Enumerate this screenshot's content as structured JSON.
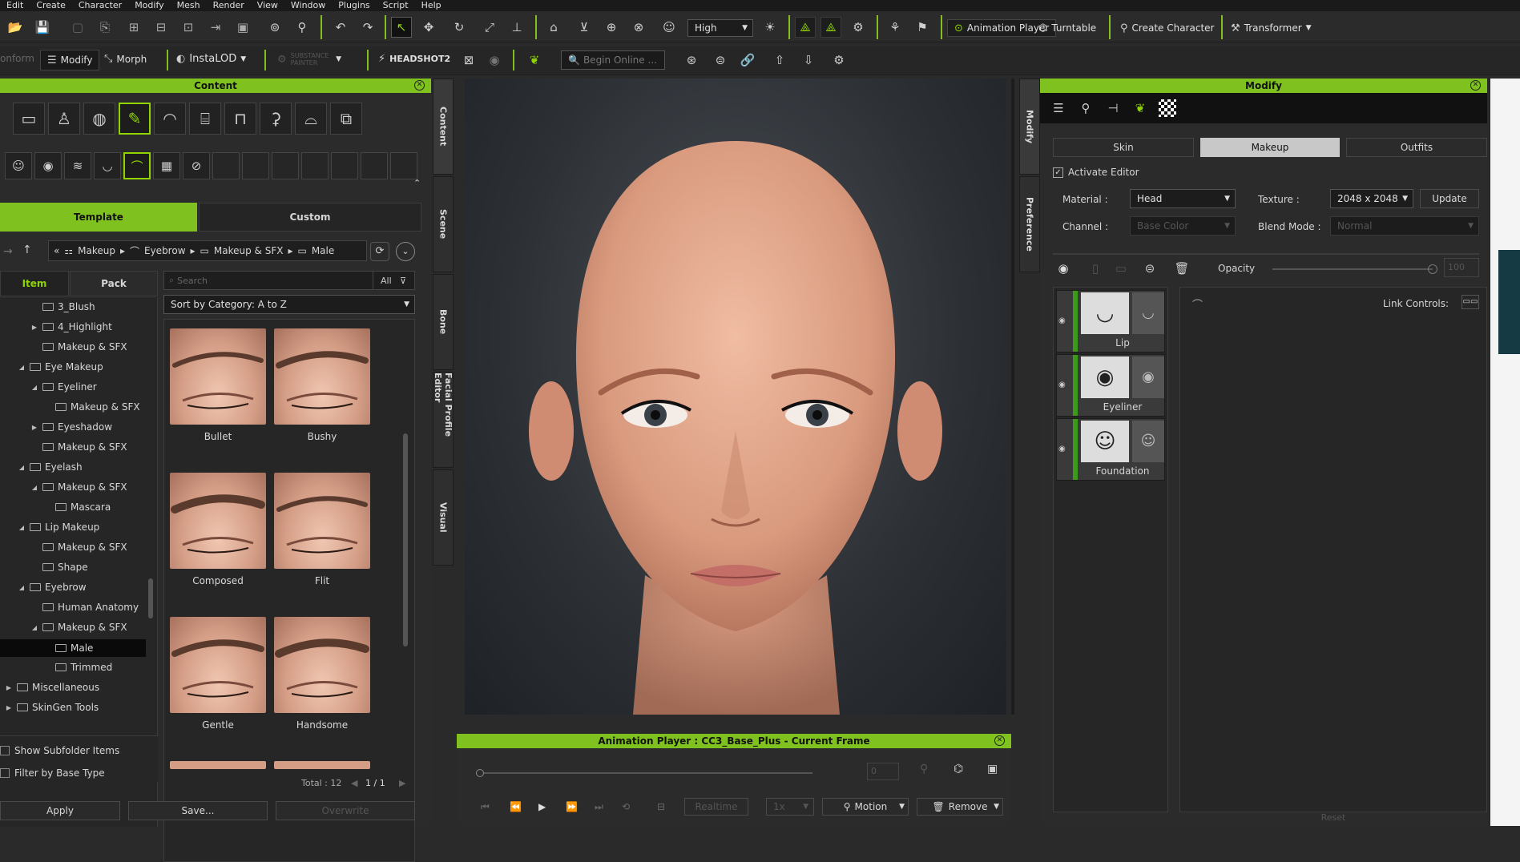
{
  "menu": [
    "Edit",
    "Create",
    "Character",
    "Modify",
    "Mesh",
    "Render",
    "View",
    "Window",
    "Plugins",
    "Script",
    "Help"
  ],
  "toolbar1": {
    "quality": "High",
    "animation_player": "Animation Player",
    "turntable": "Turntable",
    "create_character": "Create Character",
    "transformer": "Transformer"
  },
  "toolbar2": {
    "conform": "onform",
    "modify": "Modify",
    "morph": "Morph",
    "instalod": "InstaLOD",
    "substance": "SUBSTANCE PAINTER",
    "headshot": "HEADSHOT2",
    "search_placeholder": "Begin Online ..."
  },
  "content_panel": {
    "title": "Content",
    "template_tab": "Template",
    "custom_tab": "Custom",
    "breadcrumb": [
      "Makeup",
      "Eyebrow",
      "Makeup & SFX",
      "Male"
    ],
    "item_tab": "Item",
    "pack_tab": "Pack",
    "search_placeholder": "Search",
    "filter_all": "All",
    "sort_label": "Sort by Category: A to Z",
    "tree": [
      {
        "label": "3_Blush",
        "indent": 2,
        "exp": ""
      },
      {
        "label": "4_Highlight",
        "indent": 2,
        "exp": "▶"
      },
      {
        "label": "Makeup & SFX",
        "indent": 2,
        "exp": ""
      },
      {
        "label": "Eye Makeup",
        "indent": 1,
        "exp": "◢"
      },
      {
        "label": "Eyeliner",
        "indent": 2,
        "exp": "◢"
      },
      {
        "label": "Makeup & SFX",
        "indent": 3,
        "exp": ""
      },
      {
        "label": "Eyeshadow",
        "indent": 2,
        "exp": "▶"
      },
      {
        "label": "Makeup & SFX",
        "indent": 2,
        "exp": ""
      },
      {
        "label": "Eyelash",
        "indent": 1,
        "exp": "◢"
      },
      {
        "label": "Makeup & SFX",
        "indent": 2,
        "exp": "◢"
      },
      {
        "label": "Mascara",
        "indent": 3,
        "exp": ""
      },
      {
        "label": "Lip Makeup",
        "indent": 1,
        "exp": "◢"
      },
      {
        "label": "Makeup & SFX",
        "indent": 2,
        "exp": ""
      },
      {
        "label": "Shape",
        "indent": 2,
        "exp": ""
      },
      {
        "label": "Eyebrow",
        "indent": 1,
        "exp": "◢"
      },
      {
        "label": "Human Anatomy",
        "indent": 2,
        "exp": ""
      },
      {
        "label": "Makeup & SFX",
        "indent": 2,
        "exp": "◢"
      },
      {
        "label": "Male",
        "indent": 3,
        "exp": ""
      },
      {
        "label": "Trimmed",
        "indent": 3,
        "exp": ""
      },
      {
        "label": "Miscellaneous",
        "indent": 0,
        "exp": "▶"
      },
      {
        "label": "SkinGen Tools",
        "indent": 0,
        "exp": "▶"
      }
    ],
    "thumbnails": [
      "Bullet",
      "Bushy",
      "Composed",
      "Flit",
      "Gentle",
      "Handsome"
    ],
    "total": "Total : 12",
    "page": "1 / 1",
    "show_subfolder": "Show Subfolder Items",
    "filter_base": "Filter by Base Type",
    "apply": "Apply",
    "save": "Save...",
    "overwrite": "Overwrite"
  },
  "side_tabs_left": [
    "Content",
    "Scene",
    "Bone",
    "Facial Profile Editor",
    "Visual"
  ],
  "side_tabs_right": [
    "Modify",
    "Preference"
  ],
  "animation_player": {
    "title": "Animation Player : CC3_Base_Plus - Current Frame",
    "frame": "0",
    "realtime": "Realtime",
    "speed": "1x",
    "motion": "Motion",
    "remove": "Remove"
  },
  "modify_panel": {
    "title": "Modify",
    "tabs": [
      "Skin",
      "Makeup",
      "Outfits"
    ],
    "activate_editor": "Activate Editor",
    "material_label": "Material :",
    "material_value": "Head",
    "texture_label": "Texture :",
    "texture_value": "2048 x 2048",
    "update": "Update",
    "channel_label": "Channel :",
    "channel_value": "Base Color",
    "blend_label": "Blend Mode :",
    "blend_value": "Normal",
    "opacity_label": "Opacity",
    "opacity_value": "100",
    "layers": [
      "Lip",
      "Eyeliner",
      "Foundation"
    ],
    "link_controls": "Link Controls:",
    "reset": "Reset"
  }
}
